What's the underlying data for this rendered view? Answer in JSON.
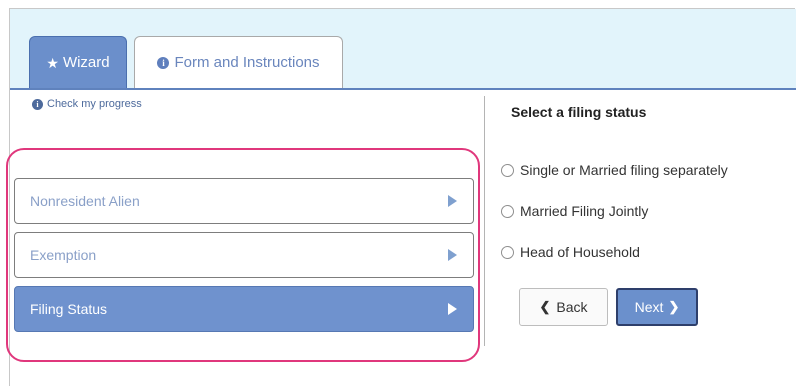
{
  "tabs": [
    {
      "label": "Wizard",
      "icon": "star-icon",
      "active": true
    },
    {
      "label": "Form and Instructions",
      "icon": "info-icon",
      "active": false
    }
  ],
  "left": {
    "check_progress": "Check my progress",
    "steps": [
      {
        "label": "Nonresident Alien",
        "active": false
      },
      {
        "label": "Exemption",
        "active": false
      },
      {
        "label": "Filing Status",
        "active": true
      }
    ]
  },
  "right": {
    "title": "Select a filing status",
    "options": [
      {
        "label": "Single or Married filing separately",
        "checked": false
      },
      {
        "label": "Married Filing Jointly",
        "checked": false
      },
      {
        "label": "Head of Household",
        "checked": false
      }
    ],
    "back_label": "Back",
    "next_label": "Next"
  },
  "colors": {
    "accent": "#6b8fcb",
    "highlight_outline": "#e0377c",
    "header_band": "#e2f4fb"
  }
}
